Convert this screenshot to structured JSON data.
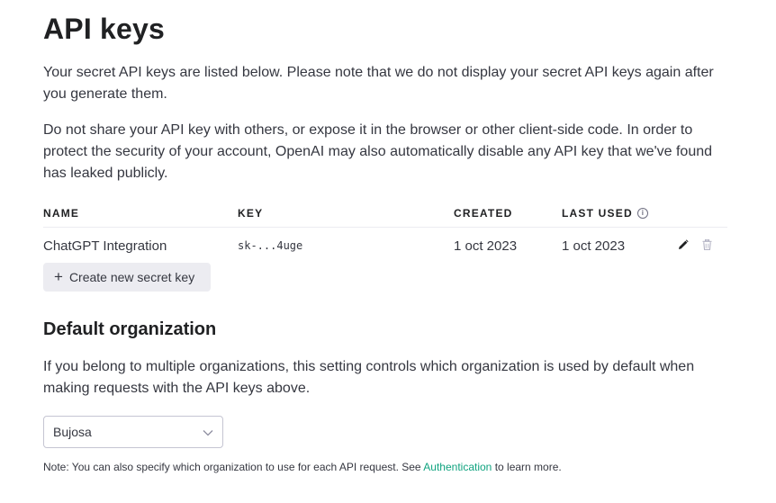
{
  "page": {
    "title": "API keys",
    "intro_1": "Your secret API keys are listed below. Please note that we do not display your secret API keys again after you generate them.",
    "intro_2": "Do not share your API key with others, or expose it in the browser or other client-side code. In order to protect the security of your account, OpenAI may also automatically disable any API key that we've found has leaked publicly."
  },
  "keys_table": {
    "headers": {
      "name": "NAME",
      "key": "KEY",
      "created": "CREATED",
      "last_used": "LAST USED"
    },
    "info_icon": "info-icon",
    "rows": [
      {
        "name": "ChatGPT Integration",
        "key": "sk-...4uge",
        "created": "1 oct 2023",
        "last_used": "1 oct 2023",
        "edit_icon": "pencil-icon",
        "delete_icon": "trash-icon"
      }
    ]
  },
  "create_button": {
    "icon": "plus-icon",
    "label": "Create new secret key"
  },
  "default_org": {
    "heading": "Default organization",
    "description": "If you belong to multiple organizations, this setting controls which organization is used by default when making requests with the API keys above.",
    "selected": "Bujosa",
    "chevron_icon": "chevron-down-icon",
    "note_prefix": "Note: You can also specify which organization to use for each API request. See",
    "note_link": "Authentication",
    "note_suffix": "to learn more."
  },
  "colors": {
    "link": "#10a37f",
    "button_bg": "#ececf1",
    "text": "#353740",
    "heading": "#202123"
  }
}
